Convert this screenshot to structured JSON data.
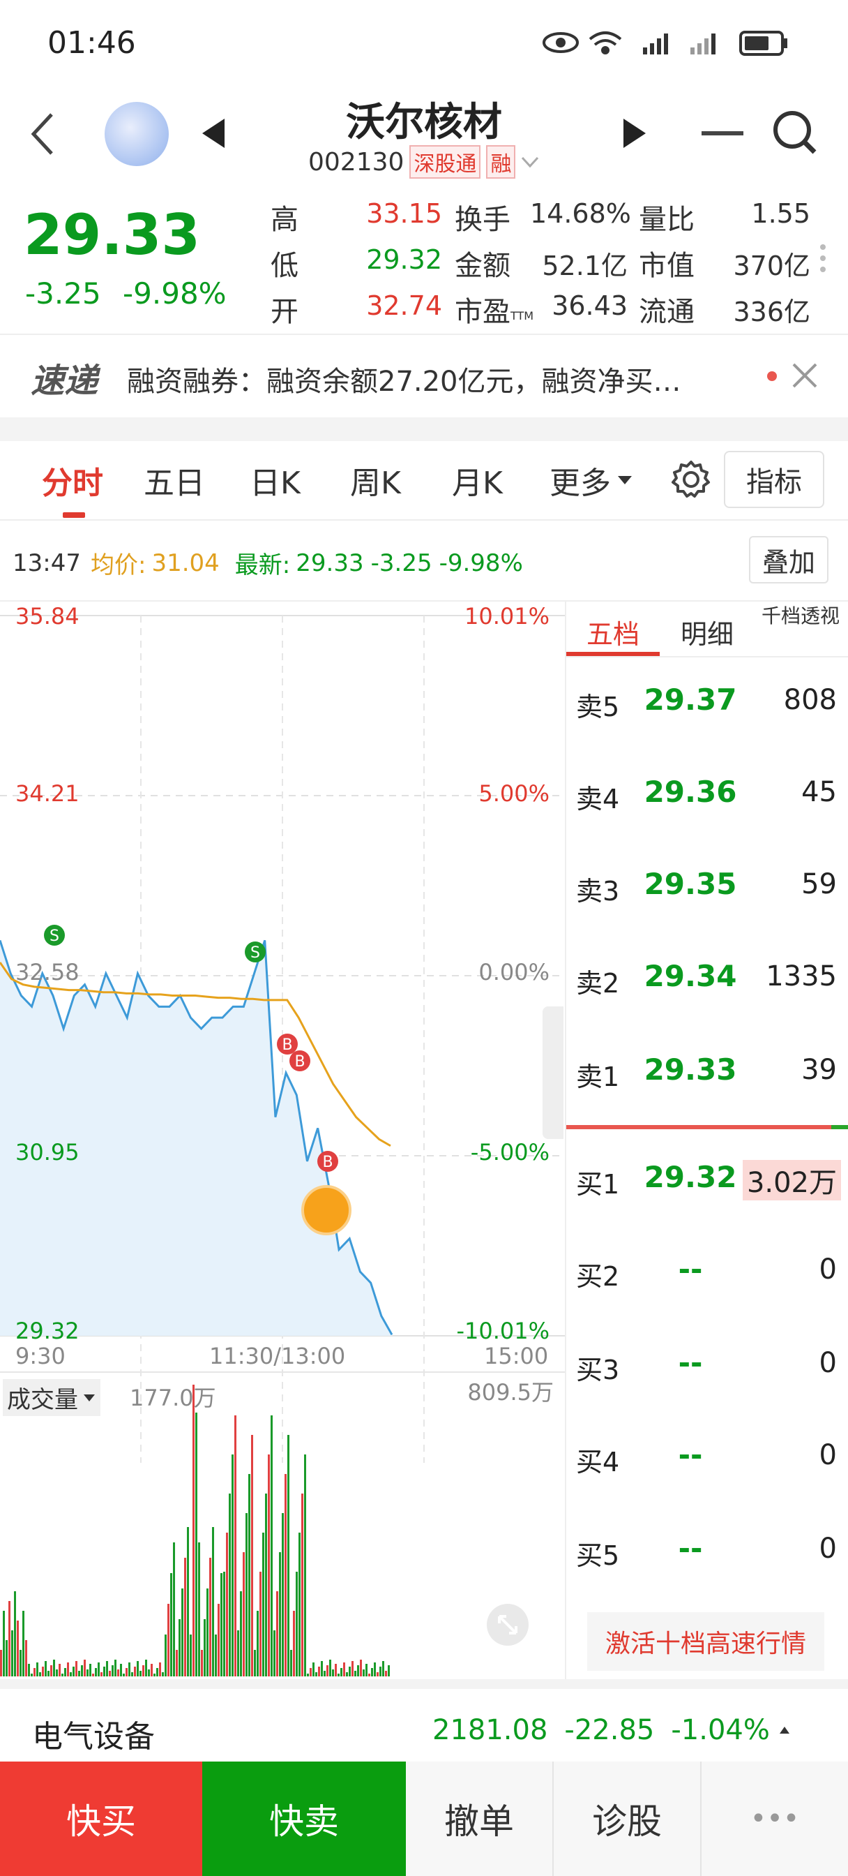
{
  "status_bar": {
    "time": "01:46"
  },
  "header": {
    "stock_name": "沃尔核材",
    "stock_code": "002130",
    "tag_exchange": "深股通",
    "tag_margin": "融"
  },
  "quote": {
    "price": "29.33",
    "change": "-3.25",
    "change_pct": "-9.98%",
    "high_label": "高",
    "high": "33.15",
    "low_label": "低",
    "low": "29.32",
    "open_label": "开",
    "open": "32.74",
    "turnover_label": "换手",
    "turnover": "14.68%",
    "amount_label": "金额",
    "amount": "52.1亿",
    "pe_label": "市盈",
    "pe_sub": "TTM",
    "pe": "36.43",
    "vol_ratio_label": "量比",
    "vol_ratio": "1.55",
    "mkt_cap_label": "市值",
    "mkt_cap": "370亿",
    "float_cap_label": "流通",
    "float_cap": "336亿"
  },
  "news": {
    "logo": "速递",
    "text": "融资融券：融资余额27.20亿元，融资净买…"
  },
  "tabs": {
    "t1": "分时",
    "t2": "五日",
    "t3": "日K",
    "t4": "周K",
    "t5": "月K",
    "t6": "更多",
    "indicator": "指标",
    "overlay": "叠加"
  },
  "info_line": {
    "time": "13:47",
    "avg_label": "均价:",
    "avg": "31.04",
    "latest_label": "最新:",
    "latest": "29.33",
    "latest_chg": "-3.25",
    "latest_pct": "-9.98%"
  },
  "chart_axes": {
    "y_left": [
      "35.84",
      "34.21",
      "32.58",
      "30.95",
      "29.32"
    ],
    "y_right": [
      "10.01%",
      "5.00%",
      "0.00%",
      "-5.00%",
      "-10.01%"
    ],
    "x": [
      "9:30",
      "11:30/13:00",
      "15:00"
    ],
    "volume_label": "成交量",
    "volume_current": "177.0万",
    "volume_max": "809.5万"
  },
  "chart_data": {
    "type": "line",
    "title": "",
    "x_range": [
      "9:30",
      "15:00"
    ],
    "ylim": [
      29.32,
      35.84
    ],
    "prev_close": 32.58,
    "series": [
      {
        "values": [
          32.9,
          32.6,
          32.4,
          32.3,
          32.6,
          32.4,
          32.1,
          32.4,
          32.5,
          32.3,
          32.6,
          32.4,
          32.2,
          32.6,
          32.4,
          32.3,
          32.3,
          32.4,
          32.2,
          32.1,
          32.2,
          32.2,
          32.3,
          32.3,
          32.6,
          32.9,
          31.3,
          31.7,
          31.5,
          30.9,
          31.2,
          30.7,
          30.1,
          30.2,
          29.9,
          29.8,
          29.5,
          29.33
        ]
      },
      {
        "values": [
          32.7,
          32.55,
          32.5,
          32.48,
          32.47,
          32.46,
          32.45,
          32.45,
          32.44,
          32.43,
          32.43,
          32.42,
          32.42,
          32.41,
          32.41,
          32.4,
          32.4,
          32.4,
          32.39,
          32.38,
          32.38,
          32.37,
          32.37,
          32.36,
          32.36,
          32.36,
          32.2,
          32.0,
          31.8,
          31.6,
          31.45,
          31.3,
          31.2,
          31.1,
          31.04
        ]
      }
    ],
    "trade_marks": [
      "S",
      "S",
      "B",
      "B",
      "B"
    ]
  },
  "order_book": {
    "tabs": [
      "五档",
      "明细",
      "千档透视"
    ],
    "sells": [
      {
        "label": "卖5",
        "price": "29.37",
        "qty": "808"
      },
      {
        "label": "卖4",
        "price": "29.36",
        "qty": "45"
      },
      {
        "label": "卖3",
        "price": "29.35",
        "qty": "59"
      },
      {
        "label": "卖2",
        "price": "29.34",
        "qty": "1335"
      },
      {
        "label": "卖1",
        "price": "29.33",
        "qty": "39"
      }
    ],
    "buys": [
      {
        "label": "买1",
        "price": "29.32",
        "qty": "3.02万"
      },
      {
        "label": "买2",
        "price": "--",
        "qty": "0"
      },
      {
        "label": "买3",
        "price": "--",
        "qty": "0"
      },
      {
        "label": "买4",
        "price": "--",
        "qty": "0"
      },
      {
        "label": "买5",
        "price": "--",
        "qty": "0"
      }
    ],
    "activate": "激活十档高速行情"
  },
  "sector": {
    "name": "电气设备",
    "index": "2181.08",
    "change": "-22.85",
    "pct": "-1.04%"
  },
  "bottom_bar": {
    "buy": "快买",
    "sell": "快卖",
    "cancel": "撤单",
    "diagnose": "诊股",
    "more": "•••"
  }
}
